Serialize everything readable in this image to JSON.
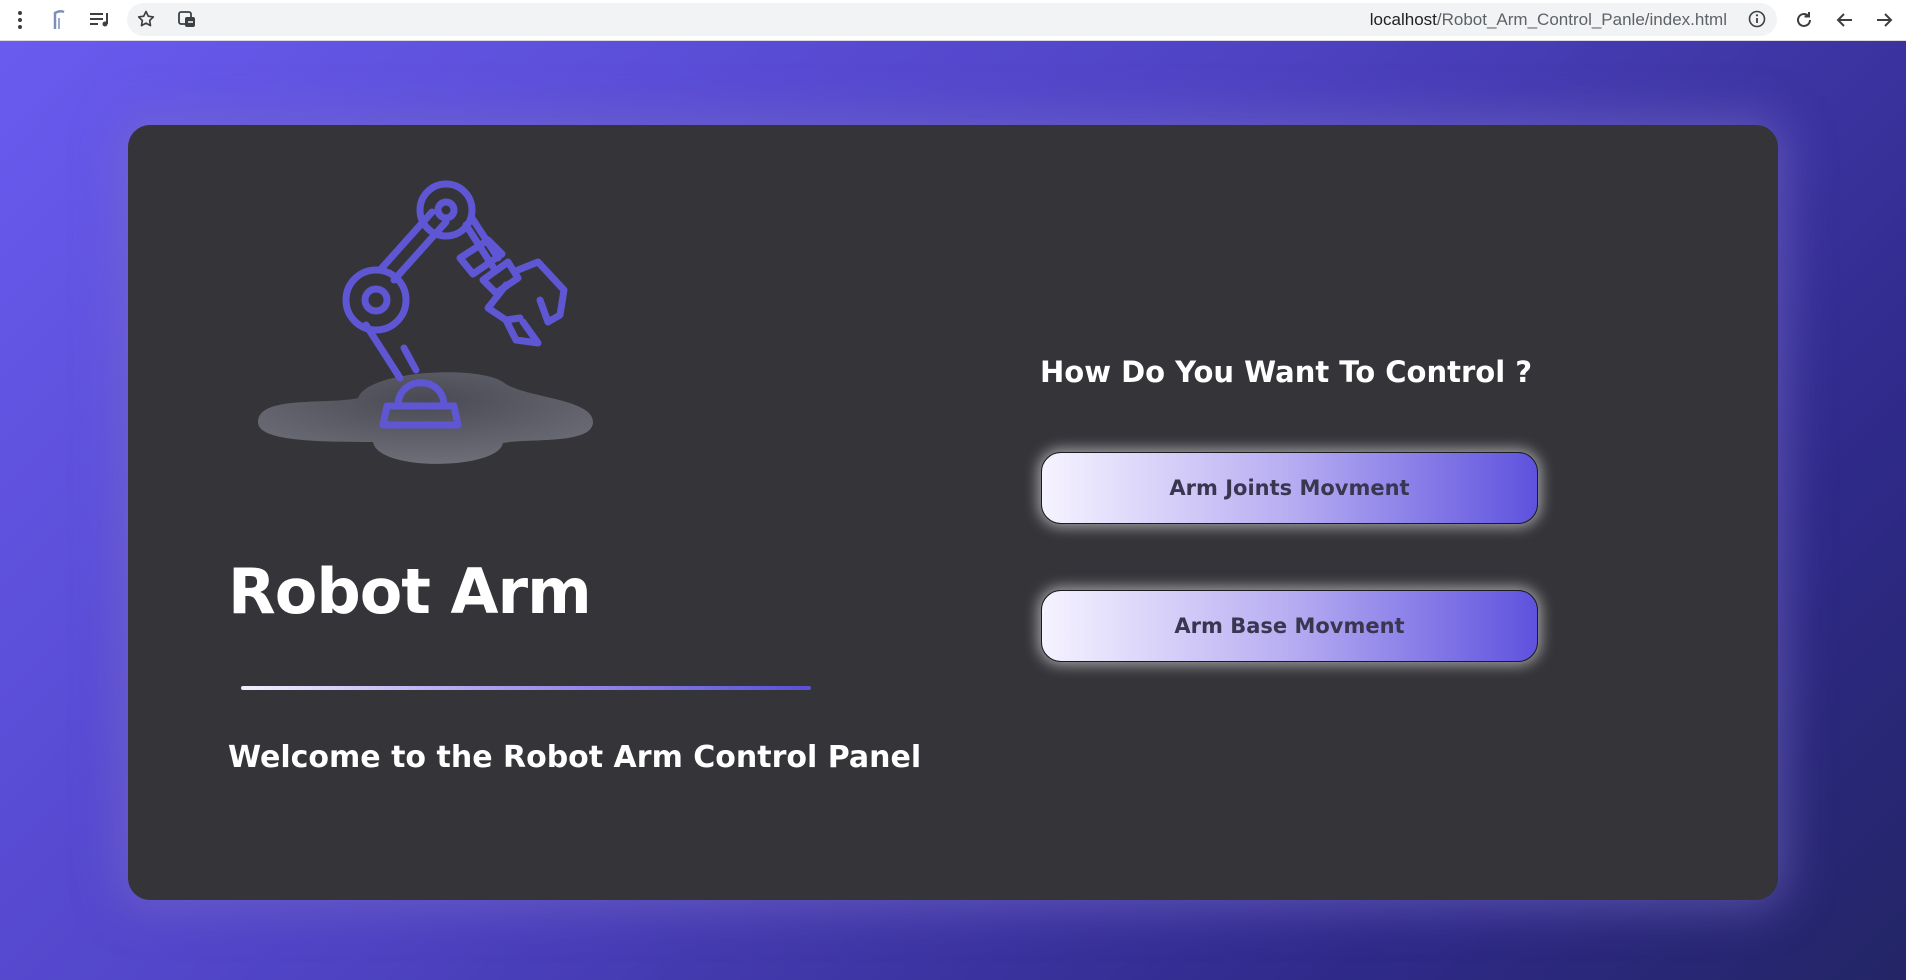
{
  "browser": {
    "url_host": "localhost",
    "url_path": "/Robot_Arm_Control_Panle/index.html"
  },
  "hero": {
    "title": "Robot Arm",
    "welcome": "Welcome to the Robot Arm Control Panel",
    "illustration": "robot-arm-icon"
  },
  "control": {
    "question": "How Do You Want To Control ?",
    "buttons": [
      {
        "label": "Arm Joints Movment"
      },
      {
        "label": "Arm Base Movment"
      }
    ]
  },
  "colors": {
    "accent": "#5b4fd6",
    "card": "#343439",
    "background_start": "#6a5cf0",
    "background_end": "#232566"
  }
}
